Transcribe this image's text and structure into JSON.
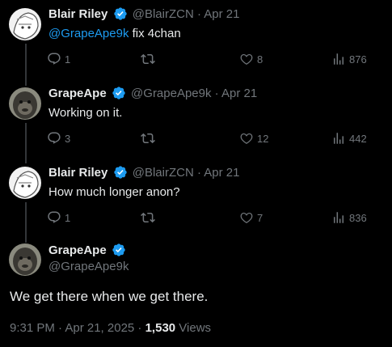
{
  "tweets": [
    {
      "name": "Blair Riley",
      "handle": "@BlairZCN",
      "sep": "·",
      "date": "Apr 21",
      "mention": "@GrapeApe9k",
      "text": " fix 4chan",
      "replies": "1",
      "reposts": "",
      "likes": "8",
      "views": "876"
    },
    {
      "name": "GrapeApe",
      "handle": "@GrapeApe9k",
      "sep": "·",
      "date": "Apr 21",
      "text": "Working on it.",
      "replies": "3",
      "reposts": "",
      "likes": "12",
      "views": "442"
    },
    {
      "name": "Blair Riley",
      "handle": "@BlairZCN",
      "sep": "·",
      "date": "Apr 21",
      "text": "How much longer anon?",
      "replies": "1",
      "reposts": "",
      "likes": "7",
      "views": "836"
    }
  ],
  "main": {
    "name": "GrapeApe",
    "handle": "@GrapeApe9k",
    "text": "We get there when we get there.",
    "time": "9:31 PM · Apr 21, 2025 · ",
    "views_count": "1,530",
    "views_label": " Views"
  },
  "colors": {
    "accent": "#1d9bf0",
    "muted": "#71767b",
    "text": "#e7e9ea",
    "bg": "#000000"
  },
  "icons": [
    "reply-icon",
    "repost-icon",
    "like-icon",
    "views-icon",
    "verified-icon"
  ]
}
